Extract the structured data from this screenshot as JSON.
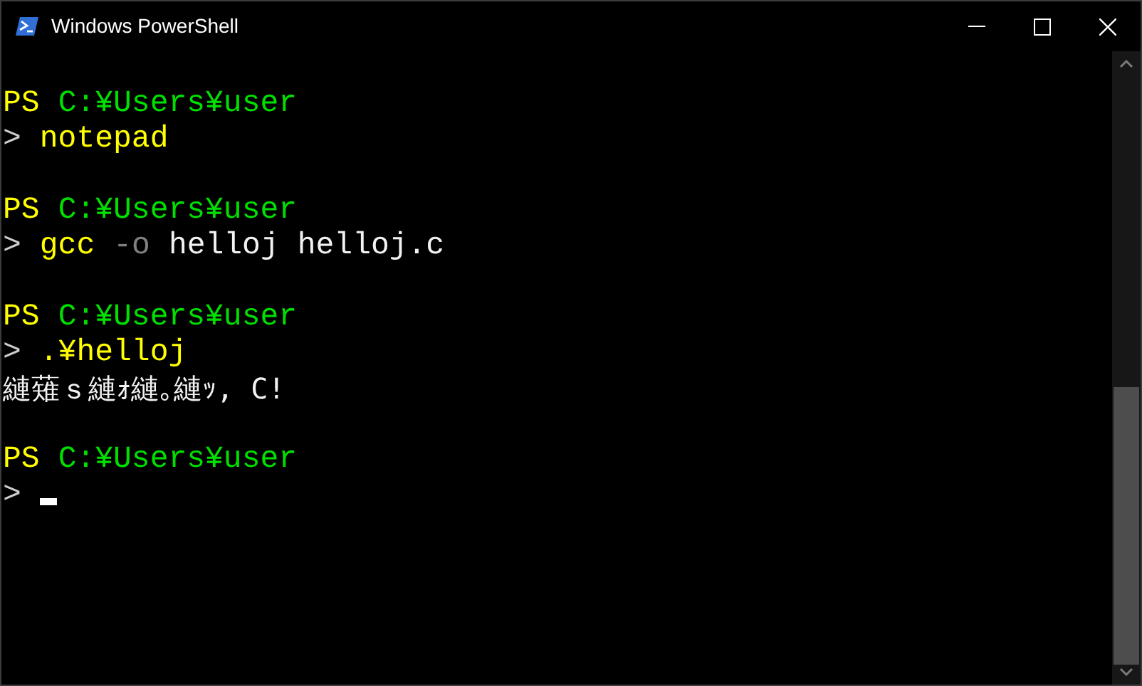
{
  "window": {
    "title": "Windows PowerShell"
  },
  "blocks": [
    {
      "prompt_label": "PS",
      "path": "C:¥Users¥user",
      "caret": ">",
      "command": [
        {
          "kind": "command",
          "text": "notepad"
        }
      ],
      "cursor": false
    },
    {
      "prompt_label": "PS",
      "path": "C:¥Users¥user",
      "caret": ">",
      "command": [
        {
          "kind": "command",
          "text": "gcc"
        },
        {
          "kind": "parameter",
          "text": "-o"
        },
        {
          "kind": "argument",
          "text": "helloj"
        },
        {
          "kind": "argument",
          "text": "helloj.c"
        }
      ],
      "cursor": false
    },
    {
      "prompt_label": "PS",
      "path": "C:¥Users¥user",
      "caret": ">",
      "command": [
        {
          "kind": "command",
          "text": ".¥helloj"
        }
      ],
      "output": [
        "縺薙ｓ縺ｫ縺｡縺ｯ, C!"
      ],
      "cursor": false
    },
    {
      "prompt_label": "PS",
      "path": "C:¥Users¥user",
      "caret": ">",
      "cursor": true
    }
  ]
}
